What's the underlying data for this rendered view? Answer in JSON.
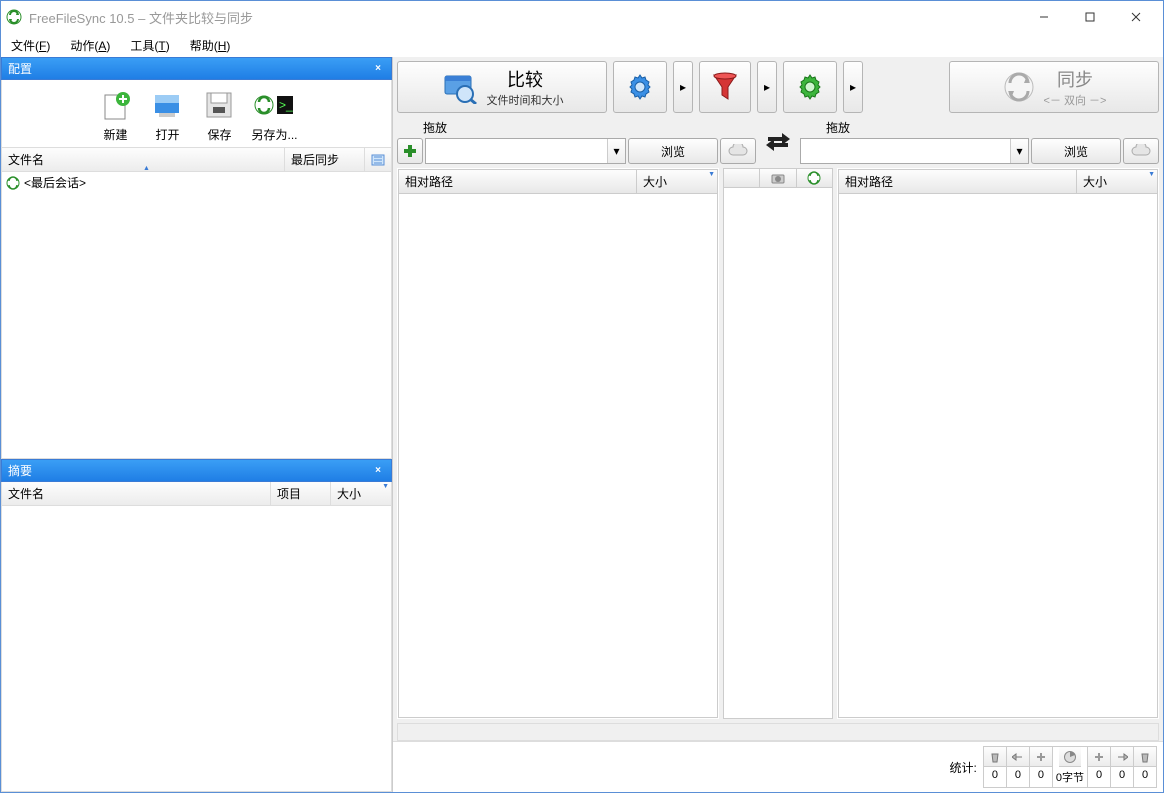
{
  "title": "FreeFileSync 10.5 – 文件夹比较与同步",
  "menu": {
    "file": "文件(",
    "file_u": "F",
    "file2": ")",
    "action": "动作(",
    "action_u": "A",
    "tools": "工具(",
    "tools_u": "T",
    "help": "帮助(",
    "help_u": "H",
    "close": ")"
  },
  "config_panel": {
    "title": "配置",
    "new": "新建",
    "open": "打开",
    "save": "保存",
    "saveas": "另存为...",
    "col_name": "文件名",
    "col_last": "最后同步",
    "row0": "<最后会话>"
  },
  "summary_panel": {
    "title": "摘要",
    "col_name": "文件名",
    "col_items": "项目",
    "col_size": "大小"
  },
  "toolbar": {
    "compare": "比较",
    "compare_sub": "文件时间和大小",
    "sync": "同步",
    "sync_sub": "<－ 双向 －>"
  },
  "folders": {
    "drag_left": "拖放",
    "drag_right": "拖放",
    "browse": "浏览"
  },
  "grids": {
    "relpath": "相对路径",
    "size": "大小"
  },
  "status": {
    "label": "统计:",
    "bytes": "0字节",
    "zero": "0"
  }
}
